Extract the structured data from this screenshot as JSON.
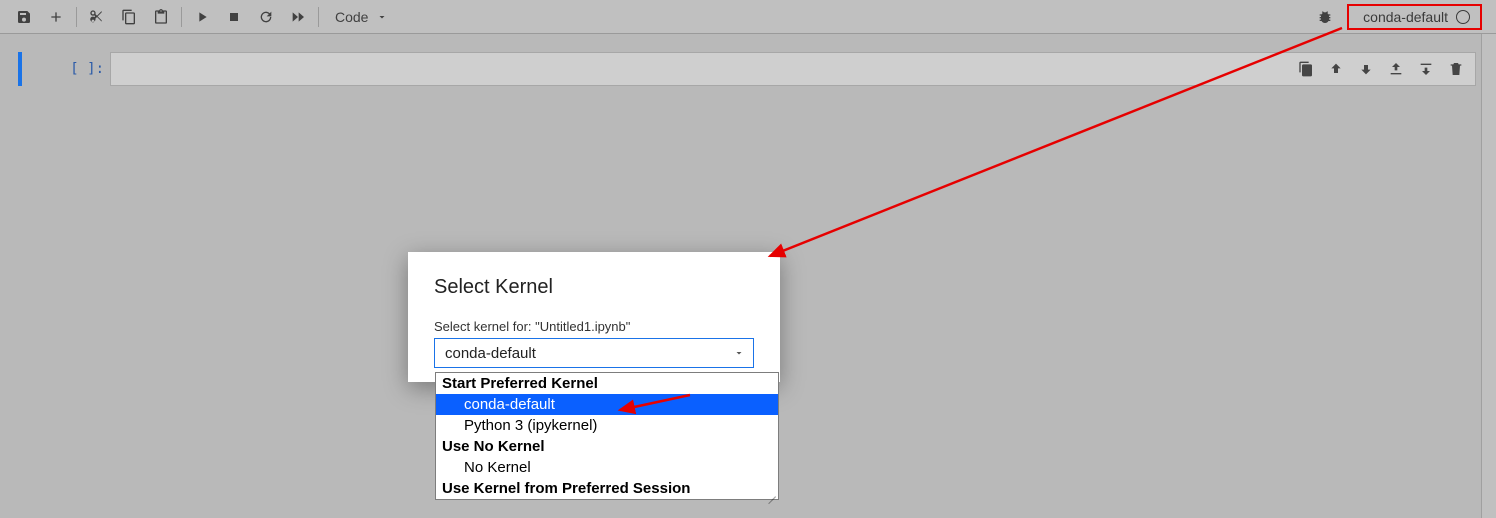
{
  "toolbar": {
    "cell_type_label": "Code"
  },
  "kernel": {
    "name": "conda-default"
  },
  "cell": {
    "prompt": "[  ]:"
  },
  "cell_actions": {
    "duplicate": "duplicate",
    "move_up": "move up",
    "move_down": "move down",
    "insert_above": "insert above",
    "insert_below": "insert below",
    "delete": "delete"
  },
  "dialog": {
    "title": "Select Kernel",
    "label": "Select kernel for: \"Untitled1.ipynb\"",
    "selected": "conda-default",
    "groups": [
      {
        "label": "Start Preferred Kernel",
        "items": [
          {
            "label": "conda-default",
            "selected": true
          },
          {
            "label": "Python 3 (ipykernel)",
            "selected": false
          }
        ]
      },
      {
        "label": "Use No Kernel",
        "items": [
          {
            "label": "No Kernel",
            "selected": false
          }
        ]
      },
      {
        "label": "Use Kernel from Preferred Session",
        "items": []
      }
    ]
  }
}
